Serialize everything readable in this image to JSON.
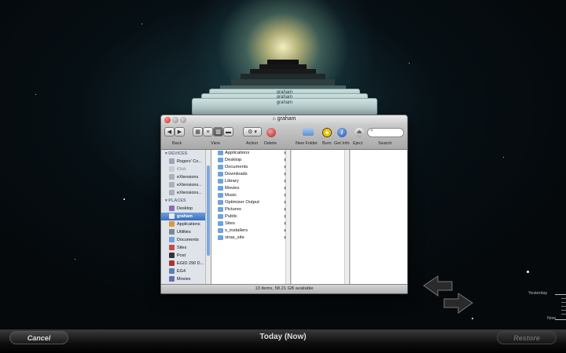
{
  "window": {
    "title": "graham",
    "background_titles": [
      "graham",
      "graham",
      "graham"
    ]
  },
  "toolbar": {
    "back_label": "Back",
    "view_label": "View",
    "action_label": "Action",
    "delete_label": "Delete",
    "new_folder_label": "New Folder",
    "burn_label": "Burn",
    "get_info_label": "Get Info",
    "eject_label": "Eject",
    "search_label": "Search"
  },
  "sidebar": {
    "devices_header": "DEVICES",
    "devices": [
      "Rogers' Co...",
      "iDisk",
      "eXtensions",
      "eXtensions...",
      "eXtensions..."
    ],
    "places_header": "PLACES",
    "places": [
      "Desktop",
      "graham",
      "Applications",
      "Utilities",
      "Documents",
      "Sites",
      "Post",
      "EGID 290 D...",
      "EG4",
      "Movies"
    ]
  },
  "files": [
    "Applications",
    "Desktop",
    "Documents",
    "Downloads",
    "Library",
    "Movies",
    "Music",
    "Optimizer Output",
    "Pictures",
    "Public",
    "Sites",
    "x_installers",
    "xtras_site"
  ],
  "status_text": "13 items, 58.21 GB available",
  "bottom": {
    "cancel_label": "Cancel",
    "today_label": "Today (Now)",
    "restore_label": "Restore"
  },
  "timeline": {
    "yesterday_label": "Yesterday",
    "now_label": "Now"
  }
}
